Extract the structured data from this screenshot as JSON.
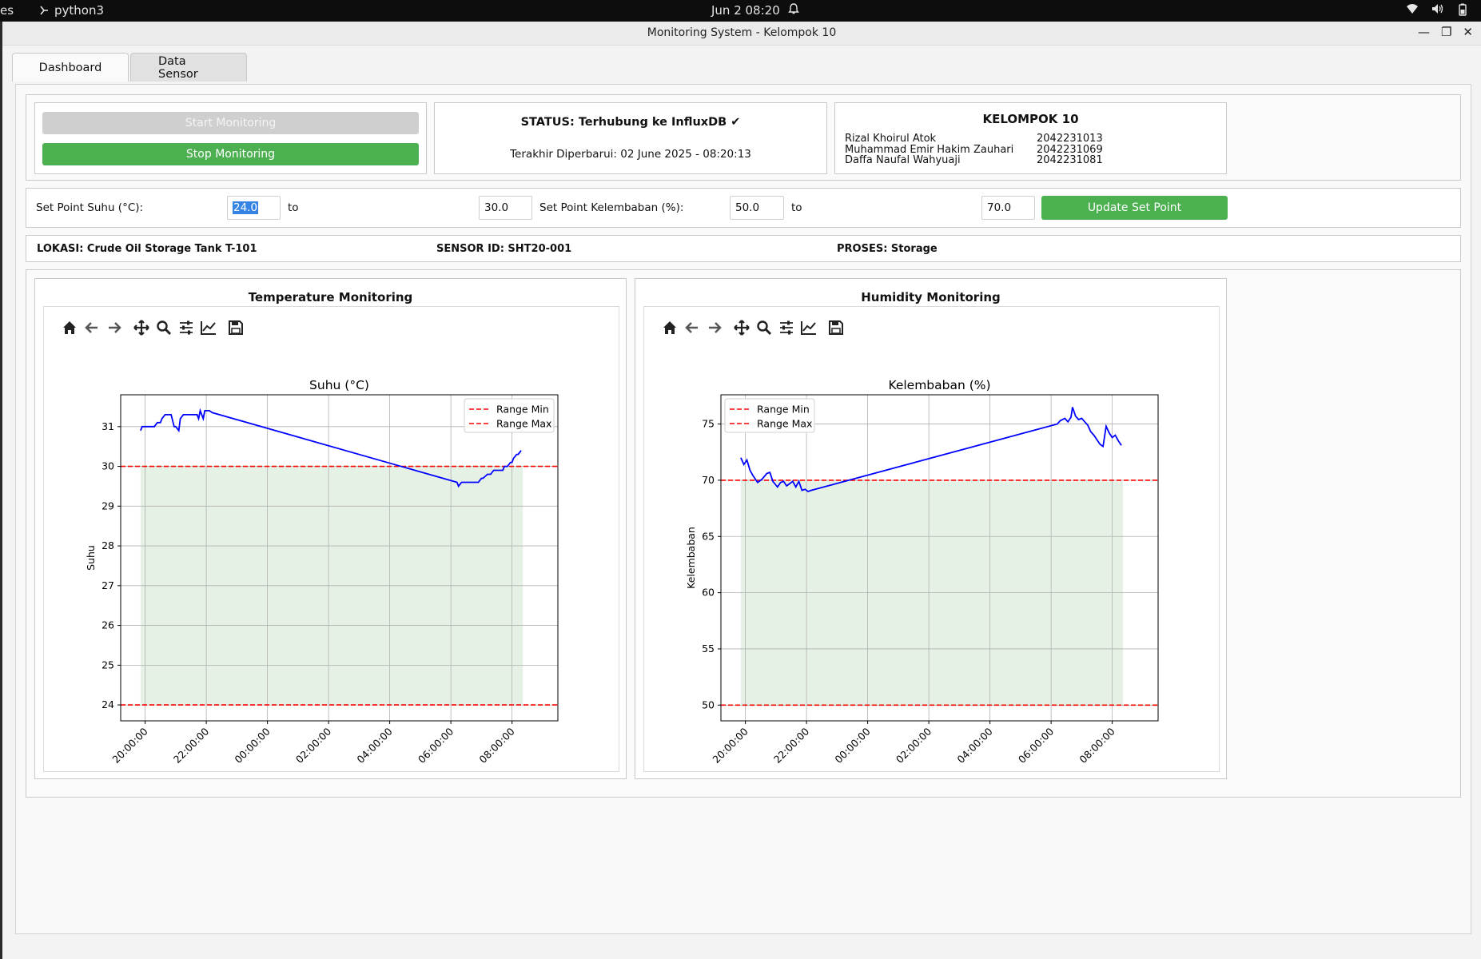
{
  "topbar": {
    "left_edge": "es",
    "app_name": "python3",
    "clock": "Jun 2  08:20"
  },
  "window": {
    "title": "Monitoring System - Kelompok 10"
  },
  "tabs": [
    {
      "label": "Dashboard",
      "active": true
    },
    {
      "label": "Data Sensor",
      "active": false
    }
  ],
  "controls": {
    "start_label": "Start Monitoring",
    "stop_label": "Stop Monitoring"
  },
  "status": {
    "text": "STATUS: Terhubung ke InfluxDB ✔",
    "updated": "Terakhir Diperbarui: 02 June 2025 - 08:20:13"
  },
  "group": {
    "title": "KELOMPOK 10",
    "members": [
      {
        "name": "Rizal Khoirul Atok",
        "nrp": "2042231013"
      },
      {
        "name": "Muhammad Emir Hakim Zauhari",
        "nrp": "2042231069"
      },
      {
        "name": "Daffa Naufal Wahyuaji",
        "nrp": "2042231081"
      }
    ]
  },
  "setpoint": {
    "suhu_label": "Set Point Suhu (°C):",
    "suhu_min": "24.0",
    "suhu_max": "30.0",
    "to_label": "to",
    "kelembaban_label": "Set Point Kelembaban (%):",
    "kelembaban_min": "50.0",
    "kelembaban_max": "70.0",
    "update_label": "Update Set Point"
  },
  "info": {
    "lokasi": "LOKASI: Crude Oil Storage Tank T-101",
    "sensor": "SENSOR ID: SHT20-001",
    "proses": "PROSES: Storage"
  },
  "panels": {
    "temp_title": "Temperature Monitoring",
    "hum_title": "Humidity Monitoring"
  },
  "colors": {
    "line": "#0000ff",
    "range": "#ff0000",
    "fill": "#e6f1e6",
    "accent_green": "#4caf50"
  },
  "chart_data": [
    {
      "type": "line",
      "title": "Suhu (°C)",
      "xlabel": "",
      "ylabel": "Suhu",
      "ylim": [
        23.6,
        31.8
      ],
      "yticks": [
        24,
        25,
        26,
        27,
        28,
        29,
        30,
        31
      ],
      "xlim": [
        -4.8,
        9.5
      ],
      "xticks": [
        -4,
        -2,
        0,
        2,
        4,
        6,
        8
      ],
      "xtick_labels": [
        "20:00:00",
        "22:00:00",
        "00:00:00",
        "02:00:00",
        "04:00:00",
        "06:00:00",
        "08:00:00"
      ],
      "grid": true,
      "legend": "upper right",
      "legend_entries": [
        "Range Min",
        "Range Max"
      ],
      "range_min": 24,
      "range_max": 30,
      "fill_x": [
        -4.15,
        8.35
      ],
      "series": [
        {
          "x": [
            -4.15,
            -4.1,
            -4.0,
            -3.7,
            -3.6,
            -3.5,
            -3.45,
            -3.35,
            -3.25,
            -3.15,
            -3.05,
            -3.0,
            -2.9,
            -2.85,
            -2.75,
            -2.7,
            -2.65,
            -2.55,
            -2.45,
            -2.3,
            -2.25,
            -2.2,
            -2.1,
            -2.05,
            -2.0,
            -1.9,
            -1.8,
            6.2,
            6.25,
            6.35,
            6.5,
            6.9,
            7.0,
            7.05,
            7.2,
            7.3,
            7.4,
            7.55,
            7.7,
            7.75,
            7.85,
            7.95,
            8.0,
            8.05,
            8.15,
            8.2,
            8.3
          ],
          "y": [
            30.9,
            31.0,
            31.0,
            31.0,
            31.1,
            31.1,
            31.2,
            31.3,
            31.3,
            31.3,
            31.0,
            31.0,
            30.9,
            31.2,
            31.3,
            31.3,
            31.3,
            31.3,
            31.3,
            31.3,
            31.2,
            31.4,
            31.2,
            31.4,
            31.4,
            31.4,
            31.35,
            29.6,
            29.5,
            29.6,
            29.6,
            29.6,
            29.7,
            29.7,
            29.8,
            29.8,
            29.9,
            29.9,
            29.9,
            30.0,
            30.0,
            30.1,
            30.1,
            30.2,
            30.3,
            30.3,
            30.4
          ]
        }
      ]
    },
    {
      "type": "line",
      "title": "Kelembaban (%)",
      "xlabel": "",
      "ylabel": "Kelembaban",
      "ylim": [
        48.6,
        77.6
      ],
      "yticks": [
        50,
        55,
        60,
        65,
        70,
        75
      ],
      "xlim": [
        -4.8,
        9.5
      ],
      "xticks": [
        -4,
        -2,
        0,
        2,
        4,
        6,
        8
      ],
      "xtick_labels": [
        "20:00:00",
        "22:00:00",
        "00:00:00",
        "02:00:00",
        "04:00:00",
        "06:00:00",
        "08:00:00"
      ],
      "grid": true,
      "legend": "upper left",
      "legend_entries": [
        "Range Min",
        "Range Max"
      ],
      "range_min": 50,
      "range_max": 70,
      "fill_x": [
        -4.15,
        8.35
      ],
      "series": [
        {
          "x": [
            -4.15,
            -4.05,
            -3.95,
            -3.85,
            -3.75,
            -3.6,
            -3.45,
            -3.3,
            -3.2,
            -3.1,
            -2.95,
            -2.85,
            -2.75,
            -2.65,
            -2.55,
            -2.45,
            -2.35,
            -2.25,
            -2.15,
            -2.05,
            -1.95,
            -1.85,
            6.2,
            6.3,
            6.45,
            6.55,
            6.65,
            6.7,
            6.8,
            6.9,
            7.0,
            7.1,
            7.2,
            7.3,
            7.4,
            7.5,
            7.6,
            7.7,
            7.8,
            7.9,
            8.0,
            8.1,
            8.2,
            8.3
          ],
          "y": [
            72.0,
            71.4,
            71.8,
            70.9,
            70.4,
            69.8,
            70.1,
            70.6,
            70.7,
            69.9,
            69.4,
            69.8,
            69.9,
            69.5,
            69.7,
            69.9,
            69.4,
            69.9,
            69.1,
            69.2,
            69.0,
            69.1,
            75.0,
            75.3,
            75.5,
            75.2,
            75.6,
            76.5,
            75.7,
            75.4,
            75.5,
            75.2,
            74.9,
            74.3,
            74.0,
            73.6,
            73.2,
            73.0,
            74.8,
            74.2,
            73.8,
            74.0,
            73.5,
            73.1
          ]
        }
      ]
    }
  ]
}
